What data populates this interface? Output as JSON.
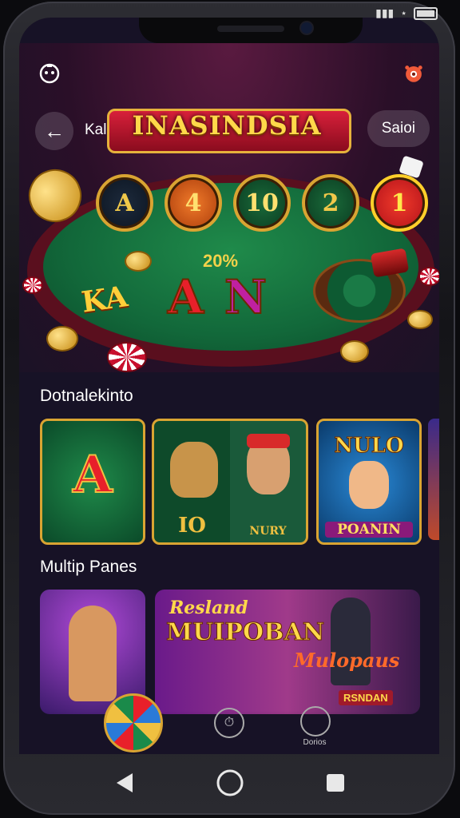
{
  "status_bar": {
    "icons": [
      "signal-icon",
      "wifi-icon",
      "battery-icon"
    ]
  },
  "header": {
    "back_label": "Kalain",
    "banner_title": "INASINDSIA",
    "right_button": "Saioi"
  },
  "hero": {
    "chips": [
      "A",
      "4",
      "10",
      "2",
      "1"
    ],
    "year": "20%",
    "logo_text": "KA",
    "big_letters": [
      "A",
      "N"
    ]
  },
  "sections": [
    {
      "title": "Dotnalekinto",
      "tiles": [
        {
          "caption": "A"
        },
        {
          "caption": "IO"
        },
        {
          "caption": "NURY"
        },
        {
          "caption": "POANIN",
          "title": "NULO"
        }
      ]
    },
    {
      "title": "Multip Panes",
      "tiles": [
        {
          "caption": ""
        },
        {
          "title_script": "Resland",
          "title": "MUIPOBAN",
          "subtitle": "Mulopaus",
          "caption": "RSNDAN"
        }
      ]
    }
  ],
  "bottom_tabs": [
    {
      "icon": "clock-icon",
      "label": ""
    },
    {
      "icon": "briefcase-icon",
      "label": "Dorios"
    }
  ],
  "system_nav": [
    "back-icon",
    "home-icon",
    "recents-icon"
  ],
  "colors": {
    "accent": "#d9a432",
    "bg": "#171226",
    "felt": "#12683a",
    "table_rim": "#5a0f1e"
  }
}
